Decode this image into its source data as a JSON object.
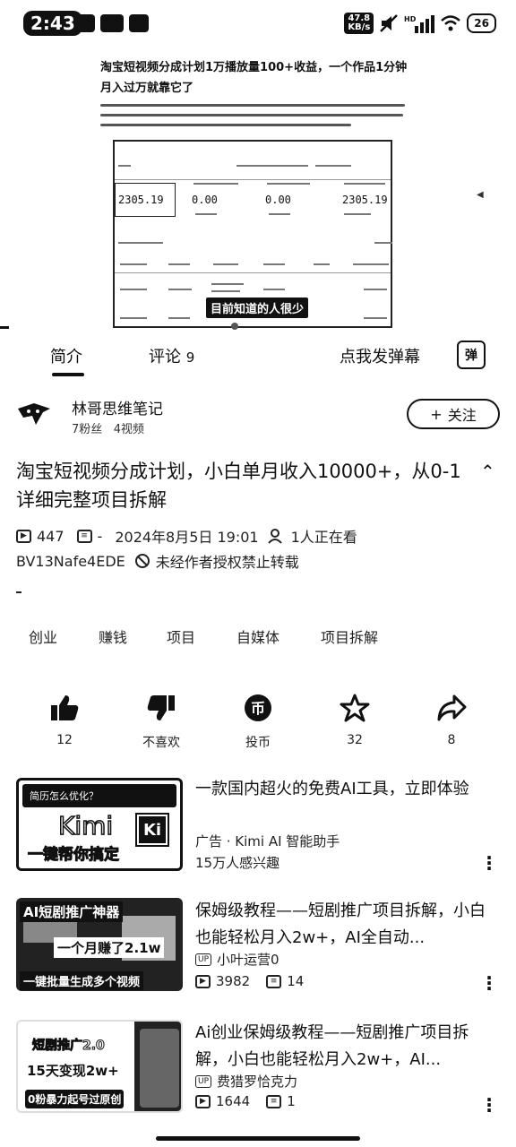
{
  "status_bar": {
    "time": "2:43",
    "net_speed_value": "47.8",
    "net_speed_unit": "KB/s",
    "battery": "26"
  },
  "video": {
    "cover_title": "淘宝短视频分成计划1万播放量100+收益，一个作品1分钟月入过万就靠它了",
    "dash_numbers": [
      "2305.19",
      "0.00",
      "0.00",
      "2305.19"
    ],
    "subtitle": "目前知道的人很少"
  },
  "tabs": {
    "intro": "简介",
    "comments": "评论",
    "comments_count": "9",
    "danmu": "点我发弹幕",
    "danmu_icon": "弹"
  },
  "uploader": {
    "name": "林哥思维笔记",
    "fans": "7粉丝",
    "videos": "4视频",
    "follow": "关注"
  },
  "video_info": {
    "title": "淘宝短视频分成计划，小白单月收入10000+，从0-1详细完整项目拆解",
    "plays": "447",
    "danmaku": "-",
    "date": "2024年8月5日 19:01",
    "watching": "1人正在看",
    "bvid": "BV13Nafe4EDE",
    "copyright": "未经作者授权禁止转载",
    "desc": "-"
  },
  "tags": [
    "创业",
    "赚钱",
    "项目",
    "自媒体",
    "项目拆解"
  ],
  "actions": {
    "like": "12",
    "dislike": "不喜欢",
    "coin": "投币",
    "favorite": "32",
    "share": "8"
  },
  "feed": [
    {
      "title": "一款国内超火的免费AI工具，立即体验",
      "sub1": "广告 · Kimi AI 智能助手",
      "sub2": "15万人感兴趣",
      "thumb_top": "简历怎么优化？",
      "thumb_big": "Kimi",
      "thumb_logo": "Ki",
      "thumb_bottom": "一键帮你搞定"
    },
    {
      "title": "保姆级教程——短剧推广项目拆解，小白也能轻松月入2w+，AI全自动...",
      "author": "小叶运营0",
      "plays": "3982",
      "danmaku": "14",
      "thumb_top": "AI短剧推广神器",
      "thumb_mid": "一个月赚了2.1w",
      "thumb_bottom": "一键批量生成多个视频"
    },
    {
      "title": "Ai创业保姆级教程——短剧推广项目拆解，小白也能轻松月入2w+，AI...",
      "author": "费猎罗恰克力",
      "plays": "1644",
      "danmaku": "1",
      "thumb_top": "短剧推广2.0",
      "thumb_mid": "15天变现2w+",
      "thumb_bottom": "0粉暴力起号过原创"
    }
  ]
}
